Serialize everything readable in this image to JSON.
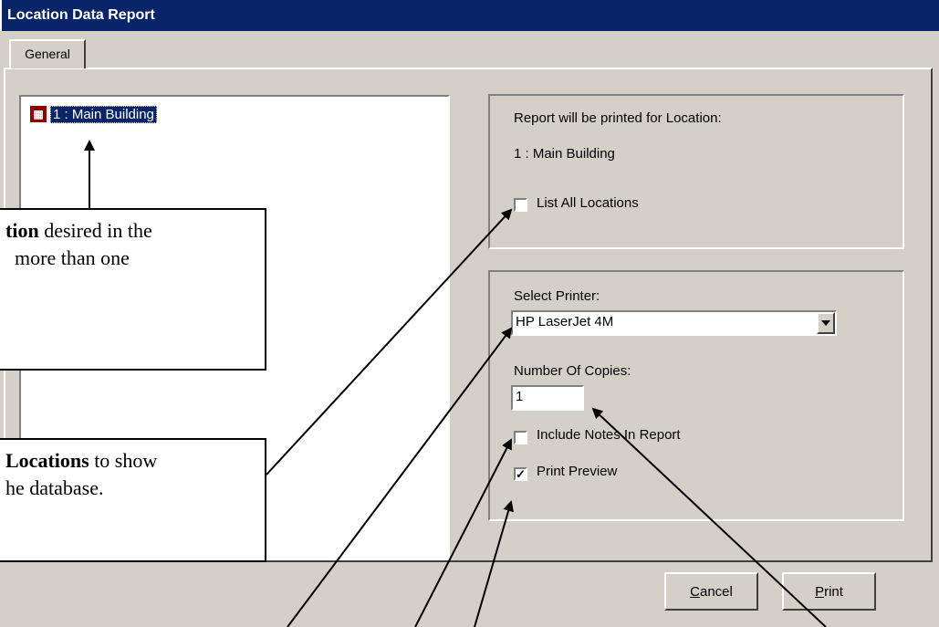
{
  "window": {
    "title": "Location Data Report"
  },
  "tabs": [
    {
      "label": "General"
    }
  ],
  "tree": {
    "items": [
      {
        "label": "1 : Main Building",
        "icon": "building-icon"
      }
    ]
  },
  "location_group": {
    "prompt": "Report will be printed for Location:",
    "value": "1 : Main Building",
    "list_all_label": "List All Locations",
    "list_all_checked": false
  },
  "print_group": {
    "printer_label": "Select Printer:",
    "printer_value": "HP LaserJet 4M",
    "copies_label": "Number Of Copies:",
    "copies_value": "1",
    "notes_label": "Include Notes In Report",
    "notes_checked": false,
    "preview_label": "Print Preview",
    "preview_checked": true
  },
  "buttons": {
    "cancel_first": "C",
    "cancel_rest": "ancel",
    "print_first": "P",
    "print_rest": "rint"
  },
  "callouts": {
    "c1_bold": "tion",
    "c1_line1_rest": " desired in the",
    "c1_line2": "more than one",
    "c2_bold": "Locations",
    "c2_line1_rest": " to show",
    "c2_line2": "he database."
  },
  "colors": {
    "titlebar": "#0a246a",
    "dialog": "#d4d0c8",
    "icon": "#8b0000"
  }
}
